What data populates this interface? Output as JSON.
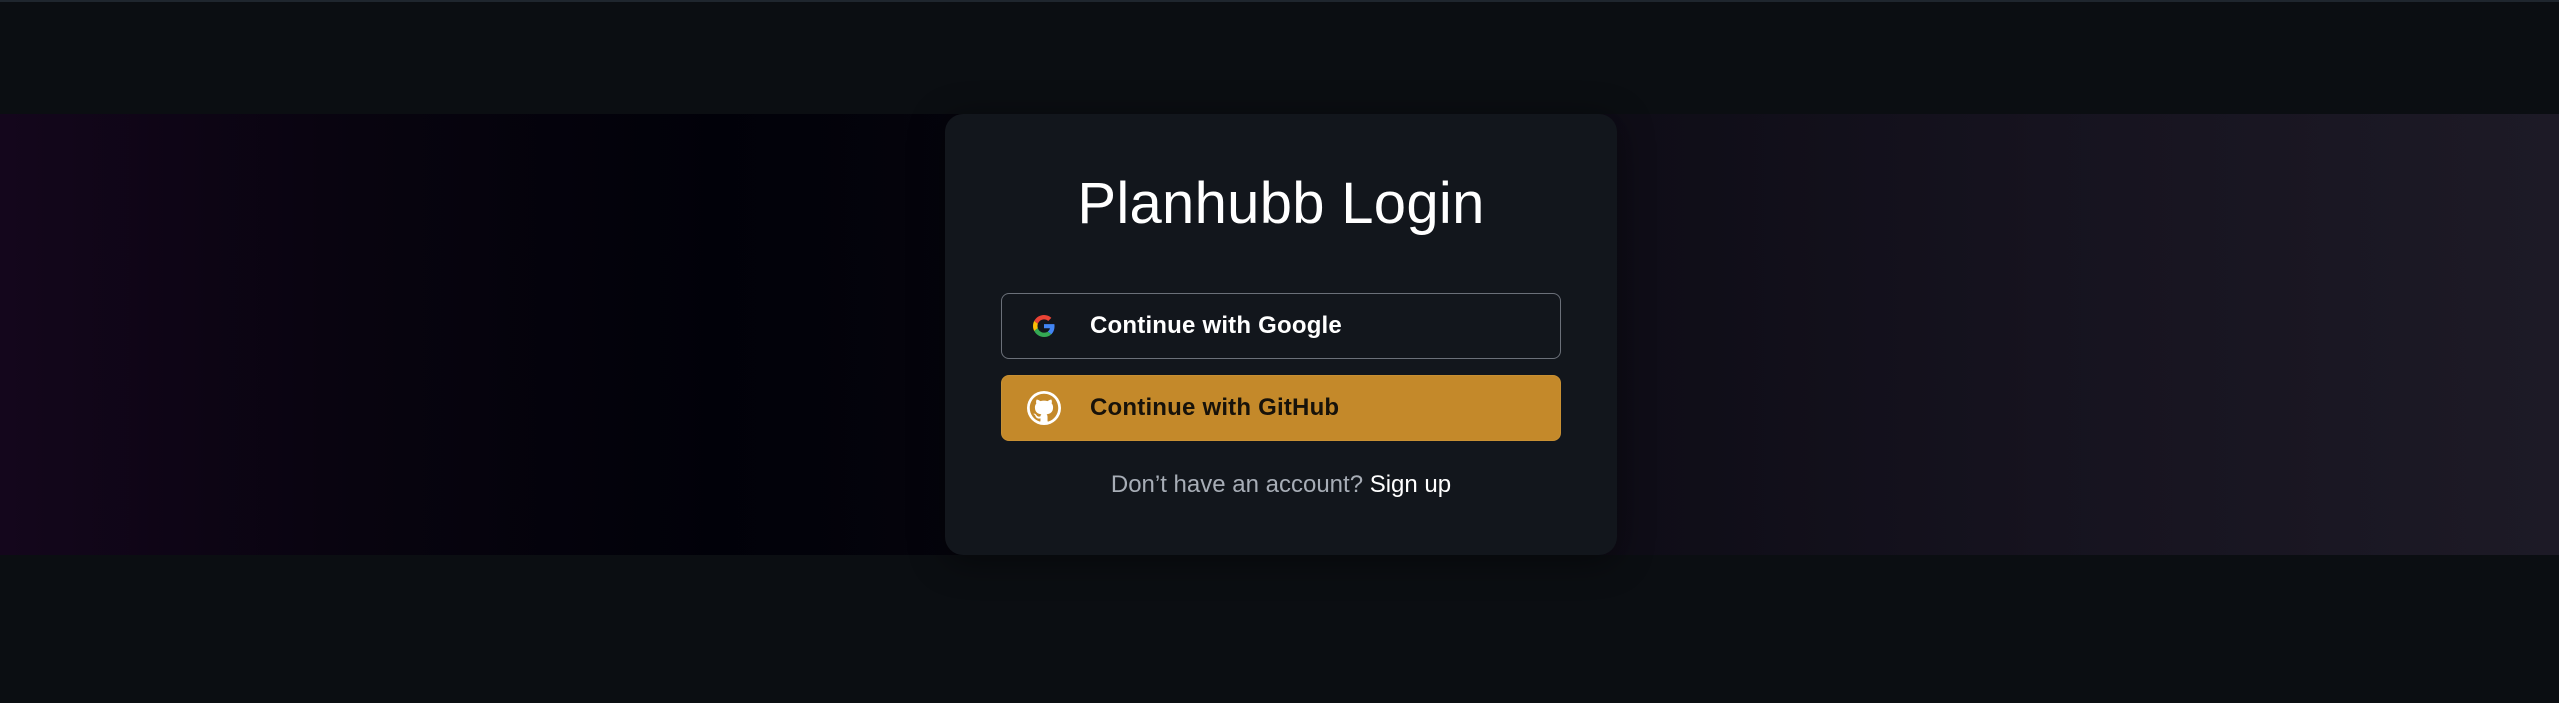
{
  "page": {
    "background_color": "#0b0e12"
  },
  "login": {
    "title": "Planhubb Login",
    "google_button": {
      "label": "Continue with Google",
      "icon": "google-icon"
    },
    "github_button": {
      "label": "Continue with GitHub",
      "icon": "github-icon",
      "color": "#c4892a"
    },
    "signup": {
      "prompt": "Don’t have an account?",
      "link_label": "Sign up"
    }
  }
}
